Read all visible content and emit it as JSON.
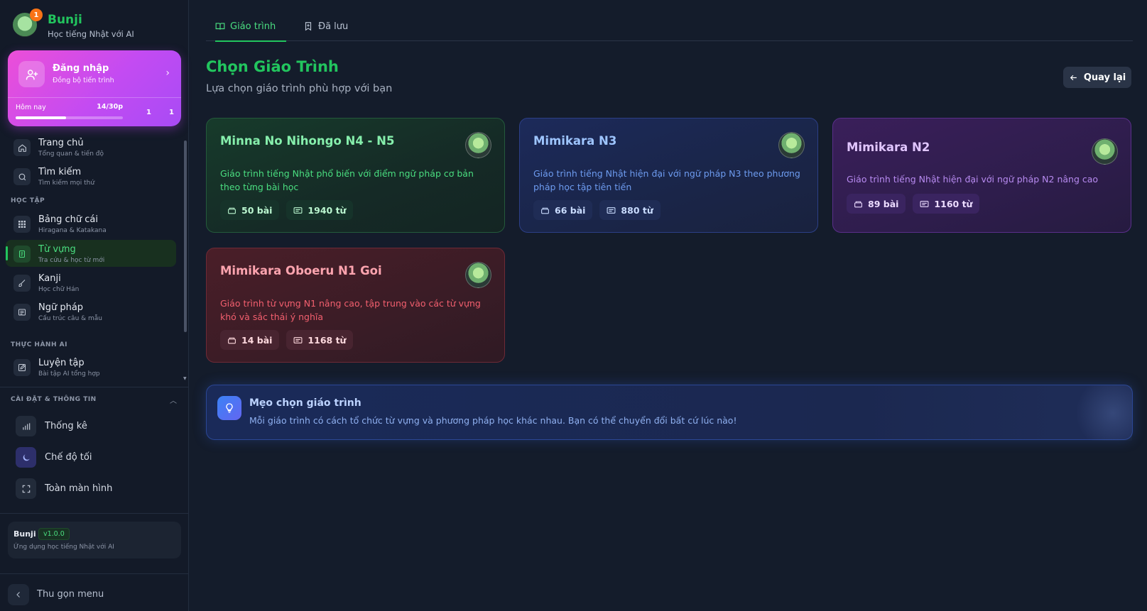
{
  "brand": {
    "name": "Bunji",
    "tagline": "Học tiếng Nhật với AI",
    "notification_count": "1"
  },
  "login": {
    "title": "Đăng nhập",
    "subtitle": "Đồng bộ tiến trình",
    "today_label": "Hôm nay",
    "progress_text": "14/30p",
    "progress_fraction": 0.47,
    "stat_a": "1",
    "stat_b": "1"
  },
  "nav": {
    "items": [
      {
        "label": "Trang chủ",
        "sub": "Tổng quan & tiến độ",
        "icon": "home-icon"
      },
      {
        "label": "Tìm kiếm",
        "sub": "Tìm kiếm mọi thứ",
        "icon": "search-icon"
      }
    ],
    "section_study": "HỌC TẬP",
    "study_items": [
      {
        "label": "Bảng chữ cái",
        "sub": "Hiragana & Katakana",
        "icon": "grid-icon"
      },
      {
        "label": "Từ vựng",
        "sub": "Tra cứu & học từ mới",
        "icon": "document-icon",
        "active": true
      },
      {
        "label": "Kanji",
        "sub": "Học chữ Hán",
        "icon": "brush-icon"
      },
      {
        "label": "Ngữ pháp",
        "sub": "Cấu trúc câu & mẫu",
        "icon": "list-icon"
      }
    ],
    "section_ai": "THỰC HÀNH AI",
    "ai_items": [
      {
        "label": "Luyện tập",
        "sub": "Bài tập AI tổng hợp",
        "icon": "edit-icon"
      }
    ]
  },
  "settings": {
    "heading": "CÀI ĐẶT & THÔNG TIN",
    "items": [
      {
        "label": "Thống kê",
        "icon": "bar-chart-icon"
      },
      {
        "label": "Chế độ tối",
        "icon": "moon-icon"
      },
      {
        "label": "Toàn màn hình",
        "icon": "fullscreen-icon"
      }
    ]
  },
  "version": {
    "name": "Bunji",
    "version": "v1.0.0",
    "description": "Ứng dụng học tiếng Nhật với AI"
  },
  "collapse_label": "Thu gọn menu",
  "tabs": [
    {
      "label": "Giáo trình",
      "icon": "book-icon",
      "active": true
    },
    {
      "label": "Đã lưu",
      "icon": "bookmark-icon",
      "active": false
    }
  ],
  "page": {
    "title": "Chọn Giáo Trình",
    "subtitle": "Lựa chọn giáo trình phù hợp với bạn",
    "back_label": "Quay lại"
  },
  "courses": [
    {
      "title": "Minna No Nihongo N4 - N5",
      "description": "Giáo trình tiếng Nhật phổ biến với điểm ngữ pháp cơ bản theo từng bài học",
      "lessons": "50 bài",
      "words": "1940 từ",
      "theme": "green"
    },
    {
      "title": "Mimikara N3",
      "description": "Giáo trình tiếng Nhật hiện đại với ngữ pháp N3 theo phương pháp học tập tiên tiến",
      "lessons": "66 bài",
      "words": "880 từ",
      "theme": "blue"
    },
    {
      "title": "Mimikara N2",
      "description": "Giáo trình tiếng Nhật hiện đại với ngữ pháp N2 nâng cao",
      "lessons": "89 bài",
      "words": "1160 từ",
      "theme": "purple"
    },
    {
      "title": "Mimikara Oboeru N1 Goi",
      "description": "Giáo trình từ vựng N1 nâng cao, tập trung vào các từ vựng khó và sắc thái ý nghĩa",
      "lessons": "14 bài",
      "words": "1168 từ",
      "theme": "red"
    }
  ],
  "tip": {
    "title": "Mẹo chọn giáo trình",
    "description": "Mỗi giáo trình có cách tổ chức từ vựng và phương pháp học khác nhau. Bạn có thể chuyển đổi bất cứ lúc nào!"
  }
}
